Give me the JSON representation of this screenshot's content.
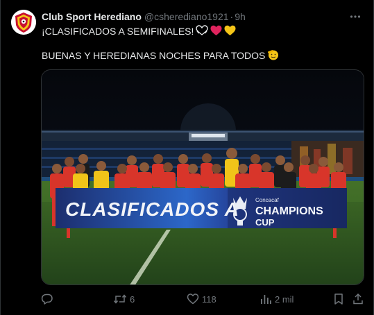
{
  "author": {
    "display_name": "Club Sport Herediano",
    "handle": "@csherediano1921",
    "separator": "·",
    "time": "9h"
  },
  "tweet": {
    "line1": "¡CLASIFICADOS A SEMIFINALES!",
    "line2": "BUENAS Y HEREDIANAS NOCHES PARA TODOS"
  },
  "media": {
    "banner_left": "CLASIFICADOS A",
    "banner_brand_small": "Concacaf",
    "banner_brand_big": "CHAMPIONS",
    "banner_brand_cup": "CUP"
  },
  "actions": {
    "reply_count": "",
    "retweet_count": "6",
    "like_count": "118",
    "views_count": "2 mil"
  },
  "icons": {
    "avatar": "club-crest-icon",
    "more": "more-icon",
    "reply": "reply-icon",
    "retweet": "retweet-icon",
    "like": "heart-icon",
    "views": "views-icon",
    "bookmark": "bookmark-icon",
    "share": "share-icon"
  },
  "colors": {
    "background": "#000000",
    "text": "#e7e9ea",
    "secondary": "#71767b",
    "border": "#2f3336",
    "jersey_red": "#d8352a",
    "jersey_yellow": "#f0c419",
    "banner_blue": "#1f3f8f"
  }
}
